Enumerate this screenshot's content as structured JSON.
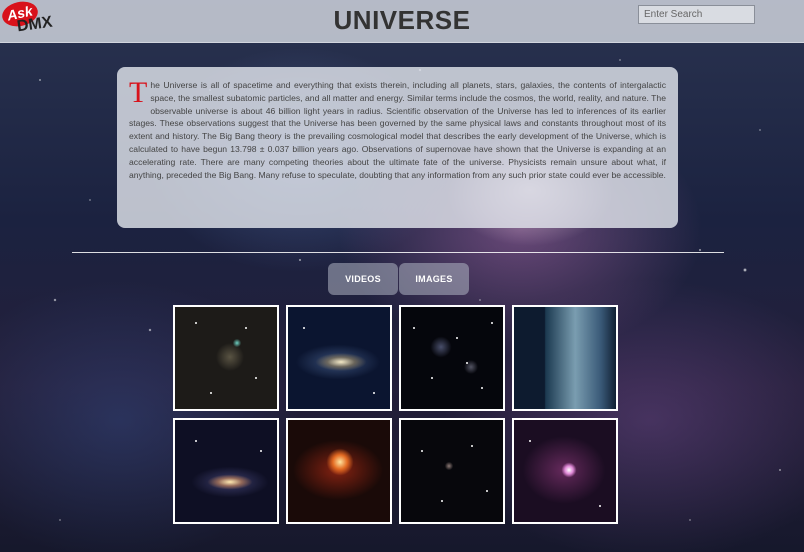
{
  "header": {
    "logo": {
      "top": "Ask",
      "bottom": "DMX"
    },
    "title": "UNIVERSE",
    "search": {
      "placeholder": "Enter Search",
      "value": ""
    }
  },
  "intro": {
    "drop_cap": "T",
    "text": "he Universe is all of spacetime and everything that exists therein, including all planets, stars, galaxies, the contents of intergalactic space, the smallest subatomic particles, and all matter and energy. Similar terms include the cosmos, the world, reality, and nature. The observable universe is about 46 billion light years in radius. Scientific observation of the Universe has led to inferences of its earlier stages. These observations suggest that the Universe has been governed by the same physical laws and constants throughout most of its extent and history. The Big Bang theory is the prevailing cosmological model that describes the early development of the Universe, which is calculated to have begun 13.798 ± 0.037 billion years ago. Observations of supernovae have shown that the Universe is expanding at an accelerating rate. There are many competing theories about the ultimate fate of the universe. Physicists remain unsure about what, if anything, preceded the Big Bang. Many refuse to speculate, doubting that any information from any such prior state could ever be accessible."
  },
  "tabs": [
    {
      "label": "VIDEOS"
    },
    {
      "label": "IMAGES"
    }
  ],
  "gallery": {
    "items": [
      {
        "subject": "star-cluster-image"
      },
      {
        "subject": "spiral-galaxy-image"
      },
      {
        "subject": "starfield-image"
      },
      {
        "subject": "universe-expansion-diagram-image"
      },
      {
        "subject": "galaxy-image"
      },
      {
        "subject": "planets-nebula-image"
      },
      {
        "subject": "deep-space-image"
      },
      {
        "subject": "pink-nebula-image"
      }
    ]
  },
  "colors": {
    "accent": "#d8121b",
    "header_bg": "#c8cdd7",
    "panel_bg": "#e1e4eb"
  }
}
